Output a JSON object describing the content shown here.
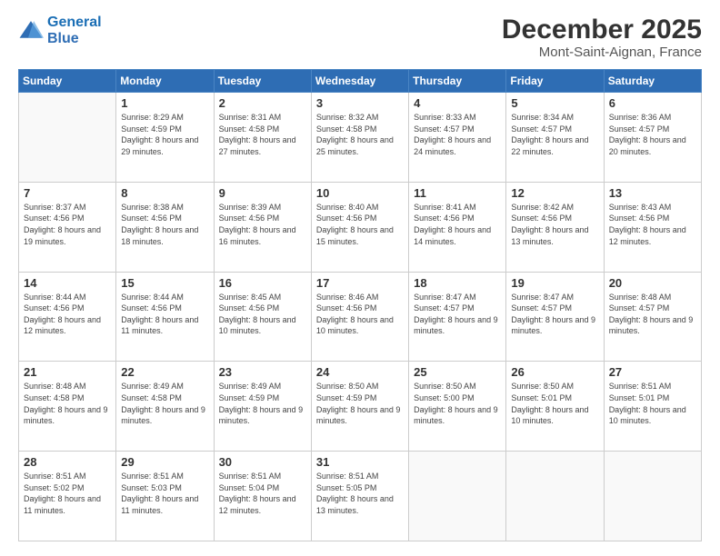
{
  "logo": {
    "line1": "General",
    "line2": "Blue"
  },
  "title": "December 2025",
  "subtitle": "Mont-Saint-Aignan, France",
  "weekdays": [
    "Sunday",
    "Monday",
    "Tuesday",
    "Wednesday",
    "Thursday",
    "Friday",
    "Saturday"
  ],
  "weeks": [
    [
      {
        "day": "",
        "sunrise": "",
        "sunset": "",
        "daylight": ""
      },
      {
        "day": "1",
        "sunrise": "Sunrise: 8:29 AM",
        "sunset": "Sunset: 4:59 PM",
        "daylight": "Daylight: 8 hours and 29 minutes."
      },
      {
        "day": "2",
        "sunrise": "Sunrise: 8:31 AM",
        "sunset": "Sunset: 4:58 PM",
        "daylight": "Daylight: 8 hours and 27 minutes."
      },
      {
        "day": "3",
        "sunrise": "Sunrise: 8:32 AM",
        "sunset": "Sunset: 4:58 PM",
        "daylight": "Daylight: 8 hours and 25 minutes."
      },
      {
        "day": "4",
        "sunrise": "Sunrise: 8:33 AM",
        "sunset": "Sunset: 4:57 PM",
        "daylight": "Daylight: 8 hours and 24 minutes."
      },
      {
        "day": "5",
        "sunrise": "Sunrise: 8:34 AM",
        "sunset": "Sunset: 4:57 PM",
        "daylight": "Daylight: 8 hours and 22 minutes."
      },
      {
        "day": "6",
        "sunrise": "Sunrise: 8:36 AM",
        "sunset": "Sunset: 4:57 PM",
        "daylight": "Daylight: 8 hours and 20 minutes."
      }
    ],
    [
      {
        "day": "7",
        "sunrise": "Sunrise: 8:37 AM",
        "sunset": "Sunset: 4:56 PM",
        "daylight": "Daylight: 8 hours and 19 minutes."
      },
      {
        "day": "8",
        "sunrise": "Sunrise: 8:38 AM",
        "sunset": "Sunset: 4:56 PM",
        "daylight": "Daylight: 8 hours and 18 minutes."
      },
      {
        "day": "9",
        "sunrise": "Sunrise: 8:39 AM",
        "sunset": "Sunset: 4:56 PM",
        "daylight": "Daylight: 8 hours and 16 minutes."
      },
      {
        "day": "10",
        "sunrise": "Sunrise: 8:40 AM",
        "sunset": "Sunset: 4:56 PM",
        "daylight": "Daylight: 8 hours and 15 minutes."
      },
      {
        "day": "11",
        "sunrise": "Sunrise: 8:41 AM",
        "sunset": "Sunset: 4:56 PM",
        "daylight": "Daylight: 8 hours and 14 minutes."
      },
      {
        "day": "12",
        "sunrise": "Sunrise: 8:42 AM",
        "sunset": "Sunset: 4:56 PM",
        "daylight": "Daylight: 8 hours and 13 minutes."
      },
      {
        "day": "13",
        "sunrise": "Sunrise: 8:43 AM",
        "sunset": "Sunset: 4:56 PM",
        "daylight": "Daylight: 8 hours and 12 minutes."
      }
    ],
    [
      {
        "day": "14",
        "sunrise": "Sunrise: 8:44 AM",
        "sunset": "Sunset: 4:56 PM",
        "daylight": "Daylight: 8 hours and 12 minutes."
      },
      {
        "day": "15",
        "sunrise": "Sunrise: 8:44 AM",
        "sunset": "Sunset: 4:56 PM",
        "daylight": "Daylight: 8 hours and 11 minutes."
      },
      {
        "day": "16",
        "sunrise": "Sunrise: 8:45 AM",
        "sunset": "Sunset: 4:56 PM",
        "daylight": "Daylight: 8 hours and 10 minutes."
      },
      {
        "day": "17",
        "sunrise": "Sunrise: 8:46 AM",
        "sunset": "Sunset: 4:56 PM",
        "daylight": "Daylight: 8 hours and 10 minutes."
      },
      {
        "day": "18",
        "sunrise": "Sunrise: 8:47 AM",
        "sunset": "Sunset: 4:57 PM",
        "daylight": "Daylight: 8 hours and 9 minutes."
      },
      {
        "day": "19",
        "sunrise": "Sunrise: 8:47 AM",
        "sunset": "Sunset: 4:57 PM",
        "daylight": "Daylight: 8 hours and 9 minutes."
      },
      {
        "day": "20",
        "sunrise": "Sunrise: 8:48 AM",
        "sunset": "Sunset: 4:57 PM",
        "daylight": "Daylight: 8 hours and 9 minutes."
      }
    ],
    [
      {
        "day": "21",
        "sunrise": "Sunrise: 8:48 AM",
        "sunset": "Sunset: 4:58 PM",
        "daylight": "Daylight: 8 hours and 9 minutes."
      },
      {
        "day": "22",
        "sunrise": "Sunrise: 8:49 AM",
        "sunset": "Sunset: 4:58 PM",
        "daylight": "Daylight: 8 hours and 9 minutes."
      },
      {
        "day": "23",
        "sunrise": "Sunrise: 8:49 AM",
        "sunset": "Sunset: 4:59 PM",
        "daylight": "Daylight: 8 hours and 9 minutes."
      },
      {
        "day": "24",
        "sunrise": "Sunrise: 8:50 AM",
        "sunset": "Sunset: 4:59 PM",
        "daylight": "Daylight: 8 hours and 9 minutes."
      },
      {
        "day": "25",
        "sunrise": "Sunrise: 8:50 AM",
        "sunset": "Sunset: 5:00 PM",
        "daylight": "Daylight: 8 hours and 9 minutes."
      },
      {
        "day": "26",
        "sunrise": "Sunrise: 8:50 AM",
        "sunset": "Sunset: 5:01 PM",
        "daylight": "Daylight: 8 hours and 10 minutes."
      },
      {
        "day": "27",
        "sunrise": "Sunrise: 8:51 AM",
        "sunset": "Sunset: 5:01 PM",
        "daylight": "Daylight: 8 hours and 10 minutes."
      }
    ],
    [
      {
        "day": "28",
        "sunrise": "Sunrise: 8:51 AM",
        "sunset": "Sunset: 5:02 PM",
        "daylight": "Daylight: 8 hours and 11 minutes."
      },
      {
        "day": "29",
        "sunrise": "Sunrise: 8:51 AM",
        "sunset": "Sunset: 5:03 PM",
        "daylight": "Daylight: 8 hours and 11 minutes."
      },
      {
        "day": "30",
        "sunrise": "Sunrise: 8:51 AM",
        "sunset": "Sunset: 5:04 PM",
        "daylight": "Daylight: 8 hours and 12 minutes."
      },
      {
        "day": "31",
        "sunrise": "Sunrise: 8:51 AM",
        "sunset": "Sunset: 5:05 PM",
        "daylight": "Daylight: 8 hours and 13 minutes."
      },
      {
        "day": "",
        "sunrise": "",
        "sunset": "",
        "daylight": ""
      },
      {
        "day": "",
        "sunrise": "",
        "sunset": "",
        "daylight": ""
      },
      {
        "day": "",
        "sunrise": "",
        "sunset": "",
        "daylight": ""
      }
    ]
  ]
}
